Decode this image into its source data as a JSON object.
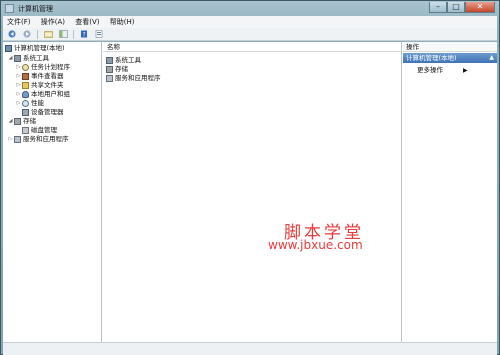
{
  "window": {
    "title": "计算机管理"
  },
  "menu": [
    "文件(F)",
    "操作(A)",
    "查看(V)",
    "帮助(H)"
  ],
  "tree": {
    "root": "计算机管理(本地)",
    "system_tools": "系统工具",
    "task_scheduler": "任务计划程序",
    "event_viewer": "事件查看器",
    "shared_folders": "共享文件夹",
    "local_users": "本地用户和组",
    "performance": "性能",
    "device_manager": "设备管理器",
    "storage": "存储",
    "disk_management": "磁盘管理",
    "services_apps": "服务和应用程序"
  },
  "list": {
    "column_name": "名称",
    "items": [
      "系统工具",
      "存储",
      "服务和应用程序"
    ]
  },
  "actions": {
    "header": "操作",
    "section": "计算机管理(本地)",
    "more": "更多操作"
  },
  "watermark": {
    "text": "脚本学堂",
    "url": "www.jbxue.com"
  },
  "colors": {
    "accent": "#3f73b6",
    "watermark": "#e63b3b"
  }
}
